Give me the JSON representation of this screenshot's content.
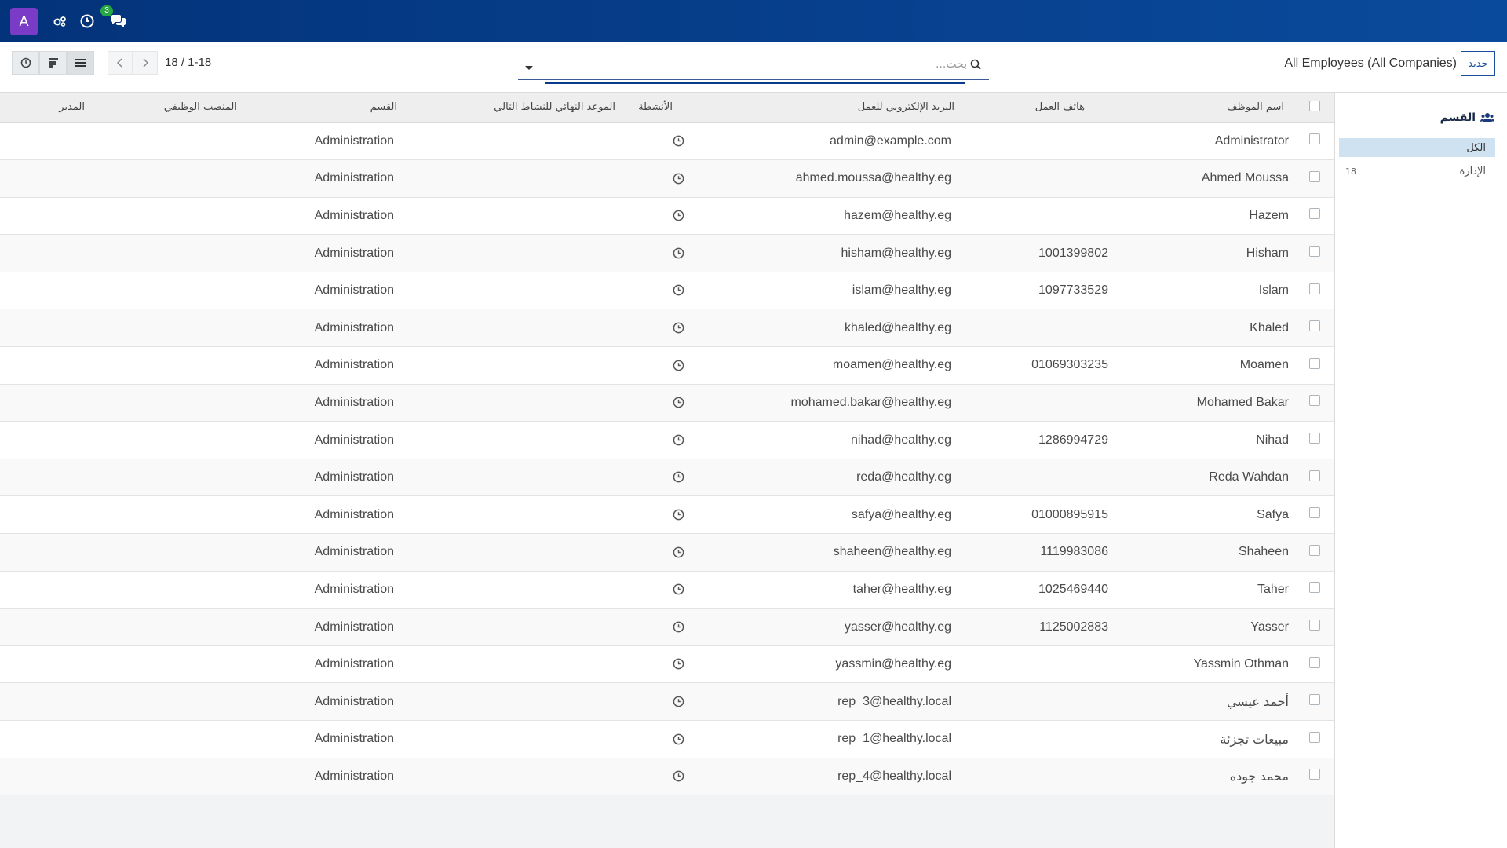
{
  "navbar": {
    "avatar_letter": "A",
    "chat_badge": "3",
    "icons": [
      "settings-icon",
      "activity-clock-icon",
      "chat-icon"
    ]
  },
  "control_panel": {
    "pager_value": "18 / 1-18",
    "search_placeholder": "بحث...",
    "title": "All Employees (All Companies)",
    "new_button": "جديد"
  },
  "side_panel": {
    "header": "القسم",
    "items": [
      {
        "label": "الكل",
        "count": ""
      },
      {
        "label": "الإدارة",
        "count": "18"
      }
    ]
  },
  "columns": {
    "name": "اسم الموظف",
    "work_phone": "هاتف العمل",
    "work_email": "البريد الإلكتروني للعمل",
    "activities": "الأنشطة",
    "next_deadline": "الموعد النهائي للنشاط التالي",
    "department": "القسم",
    "job_position": "المنصب الوظيفي",
    "manager": "المدير"
  },
  "rows": [
    {
      "name": "Administrator",
      "phone": "",
      "email": "admin@example.com",
      "department": "Administration"
    },
    {
      "name": "Ahmed Moussa",
      "phone": "",
      "email": "ahmed.moussa@healthy.eg",
      "department": "Administration"
    },
    {
      "name": "Hazem",
      "phone": "",
      "email": "hazem@healthy.eg",
      "department": "Administration"
    },
    {
      "name": "Hisham",
      "phone": "1001399802",
      "email": "hisham@healthy.eg",
      "department": "Administration"
    },
    {
      "name": "Islam",
      "phone": "1097733529",
      "email": "islam@healthy.eg",
      "department": "Administration"
    },
    {
      "name": "Khaled",
      "phone": "",
      "email": "khaled@healthy.eg",
      "department": "Administration"
    },
    {
      "name": "Moamen",
      "phone": "01069303235",
      "email": "moamen@healthy.eg",
      "department": "Administration"
    },
    {
      "name": "Mohamed Bakar",
      "phone": "",
      "email": "mohamed.bakar@healthy.eg",
      "department": "Administration"
    },
    {
      "name": "Nihad",
      "phone": "1286994729",
      "email": "nihad@healthy.eg",
      "department": "Administration"
    },
    {
      "name": "Reda Wahdan",
      "phone": "",
      "email": "reda@healthy.eg",
      "department": "Administration"
    },
    {
      "name": "Safya",
      "phone": "01000895915",
      "email": "safya@healthy.eg",
      "department": "Administration"
    },
    {
      "name": "Shaheen",
      "phone": "1119983086",
      "email": "shaheen@healthy.eg",
      "department": "Administration"
    },
    {
      "name": "Taher",
      "phone": "1025469440",
      "email": "taher@healthy.eg",
      "department": "Administration"
    },
    {
      "name": "Yasser",
      "phone": "1125002883",
      "email": "yasser@healthy.eg",
      "department": "Administration"
    },
    {
      "name": "Yassmin Othman",
      "phone": "",
      "email": "yassmin@healthy.eg",
      "department": "Administration"
    },
    {
      "name": "أحمد عيسي",
      "phone": "",
      "email": "rep_3@healthy.local",
      "department": "Administration"
    },
    {
      "name": "مبيعات تجزئة",
      "phone": "",
      "email": "rep_1@healthy.local",
      "department": "Administration"
    },
    {
      "name": "محمد جوده",
      "phone": "",
      "email": "rep_4@healthy.local",
      "department": "Administration"
    }
  ],
  "colors": {
    "navbar_start": "#03337a",
    "navbar_end": "#0a4a9c",
    "avatar": "#7a3cc7",
    "badge": "#28a745",
    "side_active": "#cfe2f2"
  }
}
